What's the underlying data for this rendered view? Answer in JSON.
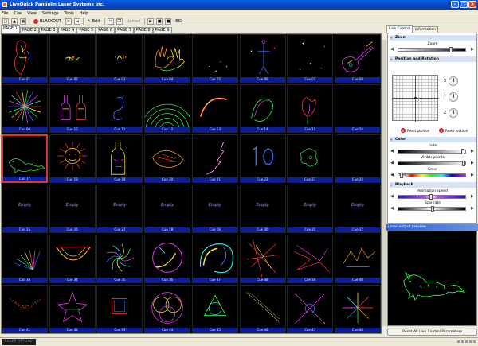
{
  "window": {
    "title": "LiveQuick Pangolin Laser Systems Inc."
  },
  "menu": [
    "File",
    "Cue",
    "View",
    "Settings",
    "Tools",
    "Help"
  ],
  "toolbar": {
    "blackout": "BLACKOUT",
    "edit": "Edit",
    "upload": "Upload",
    "bid": "BID"
  },
  "page_tabs": [
    "PAGE 1",
    "PAGE 2",
    "PAGE 3",
    "PAGE 4",
    "PAGE 5",
    "PAGE 6",
    "PAGE 7",
    "PAGE 8",
    "PAGE 9"
  ],
  "grid": {
    "cues": [
      {
        "label": "Cue 01",
        "state": "art",
        "art": "lady"
      },
      {
        "label": "Cue 02",
        "state": "art",
        "art": "small"
      },
      {
        "label": "Cue 03",
        "state": "art",
        "art": "text"
      },
      {
        "label": "Cue 04",
        "state": "art",
        "art": "hands"
      },
      {
        "label": "Cue 05",
        "state": "art",
        "art": "dots"
      },
      {
        "label": "Cue 06",
        "state": "art",
        "art": "figure"
      },
      {
        "label": "Cue 07",
        "state": "art",
        "art": "dots2"
      },
      {
        "label": "Cue 08",
        "state": "art",
        "art": "guitar"
      },
      {
        "label": "Cue 09",
        "state": "art",
        "art": "rays"
      },
      {
        "label": "Cue 10",
        "state": "art",
        "art": "bottles"
      },
      {
        "label": "Cue 11",
        "state": "art",
        "art": "glyph"
      },
      {
        "label": "Cue 12",
        "state": "art",
        "art": "arcs"
      },
      {
        "label": "Cue 13",
        "state": "art",
        "art": "arc"
      },
      {
        "label": "Cue 14",
        "state": "art",
        "art": "ribbon"
      },
      {
        "label": "Cue 15",
        "state": "art",
        "art": "tulip"
      },
      {
        "label": "Cue 16",
        "state": "art",
        "art": "blank"
      },
      {
        "label": "Cue 17",
        "state": "art",
        "art": "dino"
      },
      {
        "label": "Cue 18",
        "state": "art",
        "art": "sun"
      },
      {
        "label": "Cue 19",
        "state": "art",
        "art": "bottle"
      },
      {
        "label": "Cue 20",
        "state": "art",
        "art": "hatch"
      },
      {
        "label": "Cue 21",
        "state": "art",
        "art": "zigzag"
      },
      {
        "label": "Cue 22",
        "state": "art",
        "art": "ten"
      },
      {
        "label": "Cue 23",
        "state": "art",
        "art": "splat"
      },
      {
        "label": "Cue 24",
        "state": "art",
        "art": "blank"
      },
      {
        "label": "Cue 25",
        "state": "empty"
      },
      {
        "label": "Cue 26",
        "state": "empty"
      },
      {
        "label": "Cue 27",
        "state": "empty"
      },
      {
        "label": "Cue 28",
        "state": "empty"
      },
      {
        "label": "Cue 29",
        "state": "empty"
      },
      {
        "label": "Cue 30",
        "state": "empty"
      },
      {
        "label": "Cue 31",
        "state": "empty"
      },
      {
        "label": "Cue 32",
        "state": "empty"
      },
      {
        "label": "Cue 33",
        "state": "art",
        "art": "fan"
      },
      {
        "label": "Cue 34",
        "state": "art",
        "art": "vee"
      },
      {
        "label": "Cue 35",
        "state": "art",
        "art": "burst"
      },
      {
        "label": "Cue 36",
        "state": "art",
        "art": "circle"
      },
      {
        "label": "Cue 37",
        "state": "art",
        "art": "swirl"
      },
      {
        "label": "Cue 38",
        "state": "art",
        "art": "lines"
      },
      {
        "label": "Cue 39",
        "state": "art",
        "art": "star"
      },
      {
        "label": "Cue 40",
        "state": "art",
        "art": "crown"
      },
      {
        "label": "Cue 41",
        "state": "art",
        "art": "curve"
      },
      {
        "label": "Cue 42",
        "state": "art",
        "art": "star2"
      },
      {
        "label": "Cue 43",
        "state": "art",
        "art": "square"
      },
      {
        "label": "Cue 44",
        "state": "art",
        "art": "rings"
      },
      {
        "label": "Cue 45",
        "state": "art",
        "art": "triangle"
      },
      {
        "label": "Cue 46",
        "state": "art",
        "art": "diag"
      },
      {
        "label": "Cue 47",
        "state": "art",
        "art": "cross"
      },
      {
        "label": "Cue 48",
        "state": "art",
        "art": "spokes"
      }
    ],
    "empty_text": "Empty",
    "selected_index": 16
  },
  "right_panel": {
    "tabs": [
      "Live Control",
      "Information"
    ],
    "zoom": {
      "title": "Zoom",
      "label": "Zoom",
      "value": 0.78
    },
    "position": {
      "title": "Position and Rotation",
      "axes": [
        "X",
        "Y",
        "Z"
      ],
      "reset_position": "Reset position",
      "reset_rotation": "Reset rotation"
    },
    "color": {
      "title": "Color",
      "fade": "Fade",
      "fade_value": 0.96,
      "visible_points": "Visible points",
      "visible_value": 0.98,
      "color_label": "Color",
      "none_label": "None",
      "color_value": 0.02
    },
    "playback": {
      "title": "Playback",
      "animation_speed": "Animation speed",
      "speed_value": 0.48,
      "scanrate": "Scanrate",
      "scan_value": 0.5
    },
    "preview_title": "Laser output preview",
    "reset_all": "Reset All Live Control Parameters"
  },
  "status": {
    "laser": "LASER OFFLINE"
  },
  "colors": {
    "title_blue": "#0844c4",
    "label_blue": "#0b1f9e",
    "laser_green": "#37e64a",
    "laser_red": "#ff3838",
    "laser_blue": "#3d6cff",
    "laser_yellow": "#ffe23a",
    "laser_magenta": "#e63cf0",
    "laser_cyan": "#38e6e6",
    "selected_border": "#e03030"
  }
}
